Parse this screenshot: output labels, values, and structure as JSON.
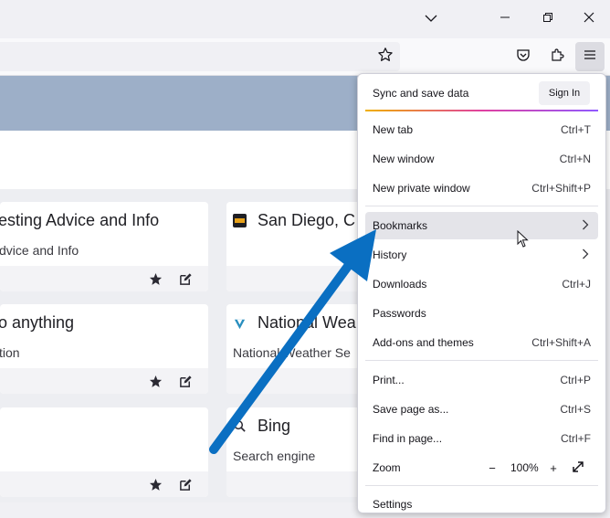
{
  "window": {
    "tabs_list_icon": "chevron-down-icon",
    "minimize_icon": "minimize-icon",
    "maximize_icon": "restore-icon",
    "close_icon": "close-icon"
  },
  "toolbar": {
    "bookmark_star_icon": "star-icon",
    "pocket_icon": "pocket-icon",
    "extensions_icon": "puzzle-icon",
    "menu_icon": "hamburger-icon"
  },
  "cards": [
    {
      "title": "esting Advice and Info",
      "desc": "dvice and Info"
    },
    {
      "title": "San Diego, C",
      "desc": ""
    },
    {
      "title": "o anything",
      "desc": "tion"
    },
    {
      "title": "National Wea",
      "desc": "National Weather Se"
    },
    {
      "title": "",
      "desc": ""
    },
    {
      "title": "Bing",
      "desc": "Search engine"
    }
  ],
  "menu": {
    "sync_label": "Sync and save data",
    "sign_in": "Sign In",
    "items": [
      {
        "label": "New tab",
        "shortcut": "Ctrl+T"
      },
      {
        "label": "New window",
        "shortcut": "Ctrl+N"
      },
      {
        "label": "New private window",
        "shortcut": "Ctrl+Shift+P"
      },
      {
        "label": "Bookmarks",
        "shortcut": ""
      },
      {
        "label": "History",
        "shortcut": ""
      },
      {
        "label": "Downloads",
        "shortcut": "Ctrl+J"
      },
      {
        "label": "Passwords",
        "shortcut": ""
      },
      {
        "label": "Add-ons and themes",
        "shortcut": "Ctrl+Shift+A"
      },
      {
        "label": "Print...",
        "shortcut": "Ctrl+P"
      },
      {
        "label": "Save page as...",
        "shortcut": "Ctrl+S"
      },
      {
        "label": "Find in page...",
        "shortcut": "Ctrl+F"
      }
    ],
    "zoom_label": "Zoom",
    "zoom_minus": "−",
    "zoom_value": "100%",
    "zoom_plus": "+",
    "settings_label": "Settings"
  },
  "colors": {
    "annotation_arrow": "#0a6fc2",
    "banner": "#9dafc8"
  }
}
